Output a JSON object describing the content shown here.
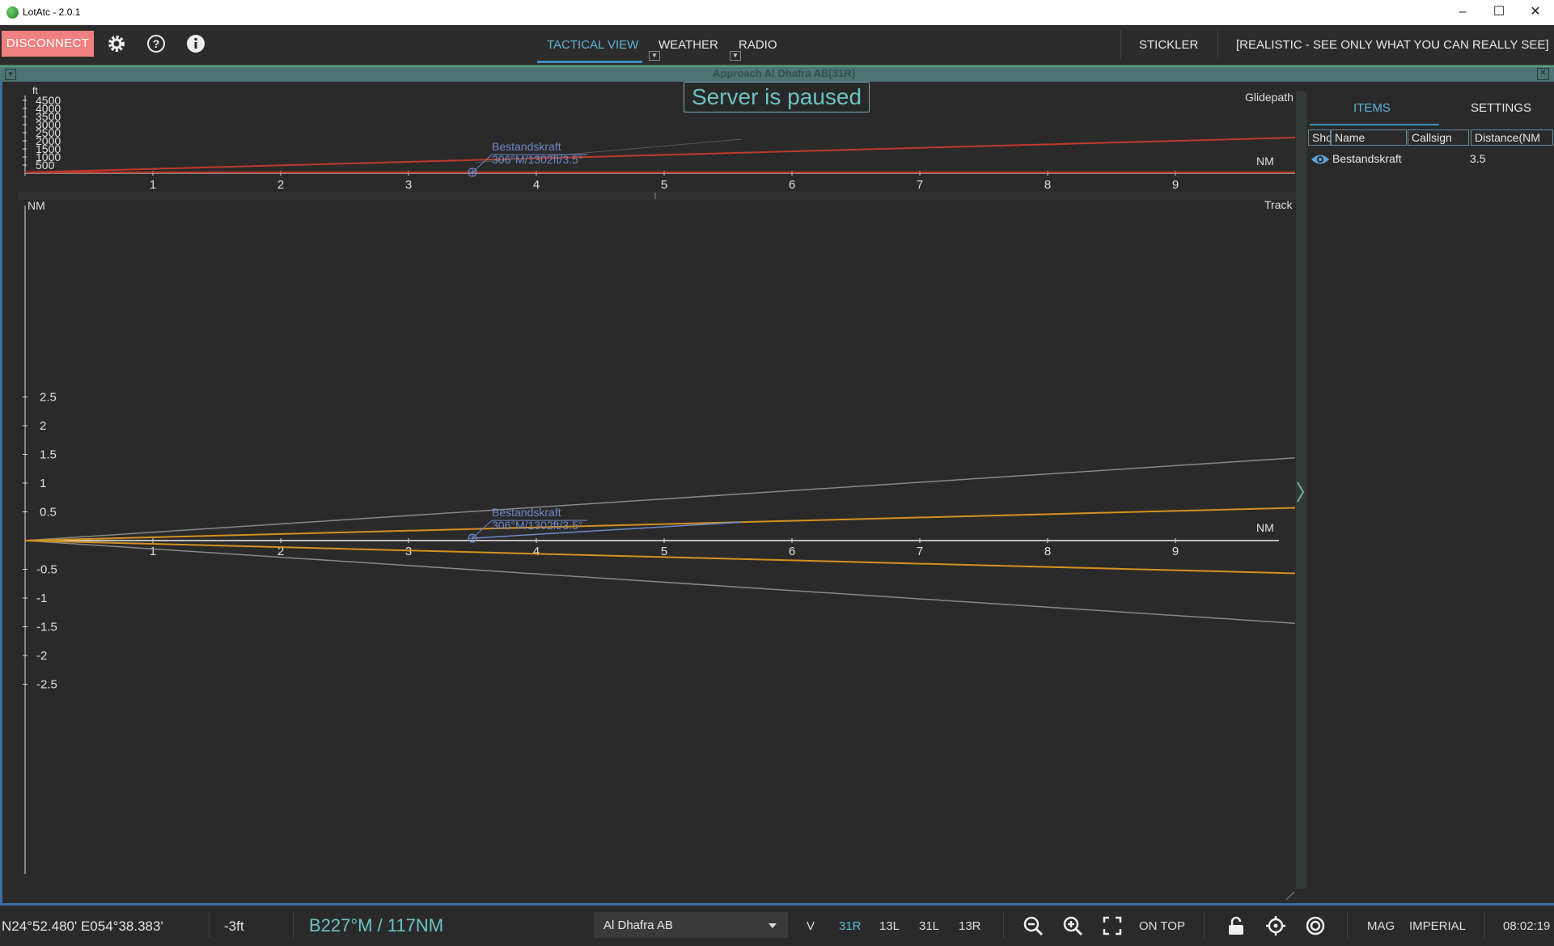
{
  "window": {
    "title": "LotAtc - 2.0.1"
  },
  "toolbar": {
    "disconnect_label": "DISCONNECT",
    "tabs": [
      {
        "label": "TACTICAL VIEW"
      },
      {
        "label": "WEATHER"
      },
      {
        "label": "RADIO"
      }
    ],
    "stickler_label": "STICKLER",
    "mode_label": "[REALISTIC - SEE ONLY WHAT YOU CAN REALLY SEE]"
  },
  "panel": {
    "title": "Approach Al Dhafra AB[31R]",
    "paused_label": "Server is paused"
  },
  "glidepath": {
    "title": "Glidepath",
    "y_unit": "ft",
    "x_unit": "NM",
    "y_ticks": [
      "500",
      "1000",
      "1500",
      "2000",
      "2500",
      "3000",
      "3500",
      "4000",
      "4500"
    ],
    "x_ticks": [
      "1",
      "2",
      "3",
      "4",
      "5",
      "6",
      "7",
      "8",
      "9"
    ],
    "contact": {
      "name": "Bestandskraft",
      "info": "306°M/1302ft/3.5°"
    }
  },
  "track": {
    "title": "Track",
    "y_unit": "NM",
    "x_unit": "NM",
    "y_ticks": [
      "2.5",
      "2",
      "1.5",
      "1",
      "0.5",
      "-0.5",
      "-1",
      "-1.5",
      "-2",
      "-2.5"
    ],
    "x_ticks": [
      "1",
      "2",
      "3",
      "4",
      "5",
      "6",
      "7",
      "8",
      "9"
    ],
    "contact": {
      "name": "Bestandskraft",
      "info": "306°M/1302ft/3.5°"
    }
  },
  "chart_data": [
    {
      "type": "line",
      "title": "Glidepath",
      "xlabel": "NM",
      "ylabel": "ft",
      "xlim": [
        0,
        9.8
      ],
      "ylim": [
        0,
        4800
      ],
      "series": [],
      "points": [
        {
          "label": "Bestandskraft",
          "x": 3.5,
          "y": 1302
        }
      ]
    },
    {
      "type": "line",
      "title": "Track",
      "xlabel": "NM",
      "ylabel": "NM",
      "xlim": [
        0,
        9.8
      ],
      "ylim": [
        -2.9,
        2.9
      ],
      "series": [],
      "points": [
        {
          "label": "Bestandskraft",
          "x": 3.5,
          "y": -0.1
        }
      ]
    }
  ],
  "side_panel": {
    "tabs": [
      {
        "label": "ITEMS"
      },
      {
        "label": "SETTINGS"
      }
    ],
    "columns": [
      "Sho",
      "Name",
      "Callsign",
      "Distance(NM"
    ],
    "rows": [
      {
        "name": "Bestandskraft",
        "callsign": "",
        "distance": "3.5"
      }
    ]
  },
  "status": {
    "coords": "N24°52.480' E054°38.383'",
    "altitude": "-3ft",
    "bearing": "B227°M / 117NM",
    "airport": "Al Dhafra AB",
    "v_label": "V",
    "runways": [
      "31R",
      "13L",
      "31L",
      "13R"
    ],
    "on_top_label": "ON TOP",
    "mag_label": "MAG",
    "imperial_label": "IMPERIAL",
    "time": "08:02:19"
  },
  "colors": {
    "accent": "#5fb4d8",
    "disconnect": "#f08080",
    "glide_red": "#c0392b",
    "track_orange": "#d4901e",
    "track_gray": "#888888",
    "contact_blue": "#6f88c8"
  }
}
